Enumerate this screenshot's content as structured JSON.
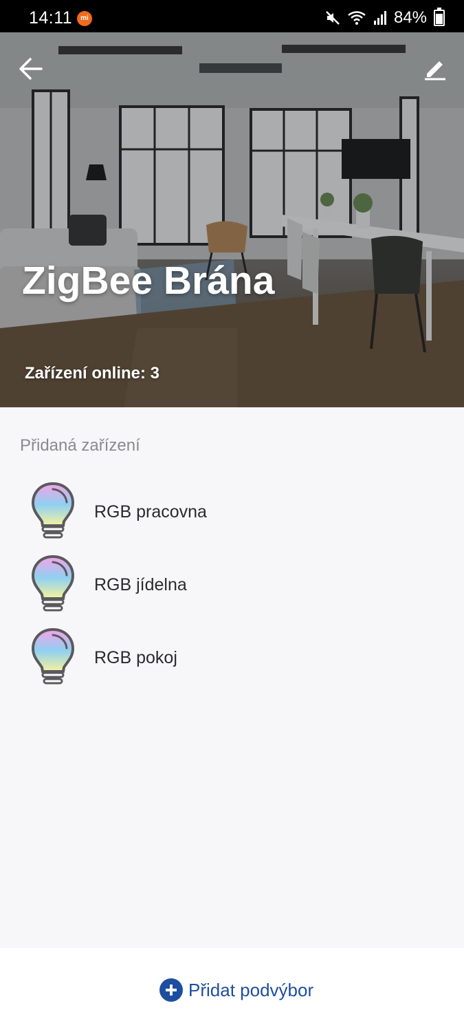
{
  "status_bar": {
    "time": "14:11",
    "battery": "84%",
    "icons": [
      "mi-notification-icon",
      "mute-icon",
      "wifi-icon",
      "signal-icon",
      "battery-icon"
    ]
  },
  "header": {
    "title": "ZigBee Brána",
    "online": "Zařízení online: 3",
    "back_icon": "arrow-left-icon",
    "edit_icon": "pencil-icon"
  },
  "section": {
    "label": "Přidaná zařízení"
  },
  "devices": [
    {
      "name": "RGB pracovna",
      "icon": "rgb-bulb-icon"
    },
    {
      "name": "RGB jídelna",
      "icon": "rgb-bulb-icon"
    },
    {
      "name": "RGB pokoj",
      "icon": "rgb-bulb-icon"
    }
  ],
  "footer": {
    "add_label": "Přidat podvýbor",
    "add_icon": "plus-circle-icon",
    "accent": "#1d4e9f"
  }
}
